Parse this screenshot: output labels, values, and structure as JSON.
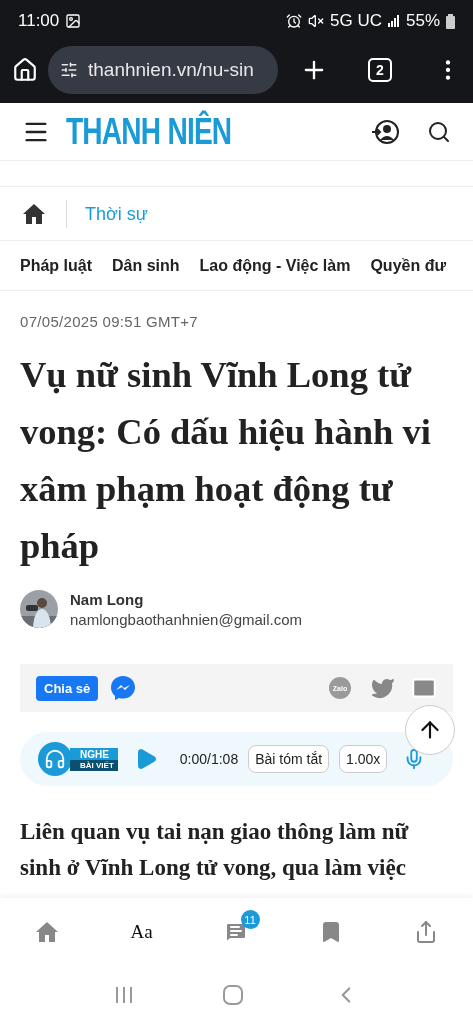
{
  "status_bar": {
    "time": "11:00",
    "network": "5G UC",
    "battery": "55%"
  },
  "browser": {
    "url": "thanhnien.vn/nu-sin",
    "tab_count": "2"
  },
  "site_header": {
    "logo": "THANH NIÊN"
  },
  "breadcrumb": {
    "section": "Thời sự"
  },
  "categories": [
    "Pháp luật",
    "Dân sinh",
    "Lao động - Việc làm",
    "Quyền đư"
  ],
  "article": {
    "date": "07/05/2025 09:51 GMT+7",
    "title": "Vụ nữ sinh Vĩnh Long tử vong: Có dấu hiệu hành vi xâm phạm hoạt động tư pháp",
    "author": {
      "name": "Nam Long",
      "email": "namlongbaothanhnien@gmail.com"
    },
    "share": {
      "label": "Chia sẻ",
      "zalo": "Zalo"
    },
    "audio": {
      "badge_top": "NGHE",
      "badge_bottom": "BÀI VIẾT",
      "time": "0:00/1:08",
      "summary": "Bài tóm tắt",
      "speed": "1.00x"
    },
    "lead": "Liên quan vụ tai nạn giao thông làm nữ sinh ở Vĩnh Long tử vong, qua làm việc"
  },
  "bottom_nav": {
    "font_label": "Aa",
    "comment_count": "11"
  }
}
